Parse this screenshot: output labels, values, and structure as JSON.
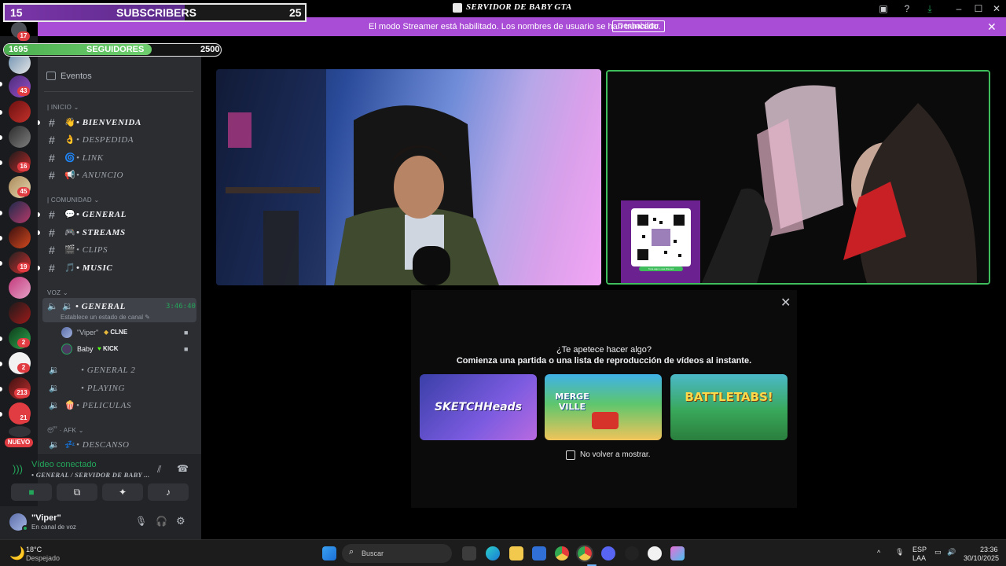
{
  "window": {
    "title": "SERVIDOR DE BABY GTA"
  },
  "overlay": {
    "subscribers": {
      "current": "15",
      "label": "SUBSCRIBERS",
      "goal": "25",
      "progress": 0.6
    },
    "followers": {
      "current": "1695",
      "label": "SEGUIDORES",
      "goal": "2500",
      "progress": 0.68,
      "clipped_server_text": "A"
    }
  },
  "banner": {
    "message": "El modo Streamer está habilitado. Los nombres de usuario se han truncado.",
    "button": "Deshabilitar",
    "close": "✕",
    "color": "#a94cd6"
  },
  "servers": {
    "badges": [
      "17",
      "43",
      "16",
      "45",
      "19",
      "2",
      "2",
      "213",
      "21"
    ],
    "new_label": "NUEVO"
  },
  "sidebar": {
    "events": "Eventos",
    "categories": {
      "inicio": "INICIO",
      "comunidad": "COMUNIDAD",
      "voz": "VOZ",
      "afk": "AFK"
    },
    "text_channels": [
      {
        "emoji": "👋",
        "name": "• BIENVENIDA"
      },
      {
        "emoji": "👌",
        "name": "• DESPEDIDA"
      },
      {
        "emoji": "🌀",
        "name": "• LINK"
      },
      {
        "emoji": "📢",
        "name": "• ANUNCIO"
      },
      {
        "emoji": "💬",
        "name": "• GENERAL"
      },
      {
        "emoji": "🎮",
        "name": "• STREAMS"
      },
      {
        "emoji": "🎬",
        "name": "• CLIPS"
      },
      {
        "emoji": "🎵",
        "name": "• MUSIC"
      }
    ],
    "voice_active": {
      "name": "• GENERAL",
      "timer": "3:46:40",
      "status_hint": "Establece un estado de canal",
      "members": [
        {
          "name": "\"Viper\"",
          "tag": "CLNE"
        },
        {
          "name": "Baby",
          "tag": "KICK"
        }
      ]
    },
    "voice_channels": [
      {
        "emoji": "",
        "name": "• GENERAL 2"
      },
      {
        "emoji": "",
        "name": "• PLAYING"
      },
      {
        "emoji": "🍿",
        "name": "• PELICULAS"
      }
    ],
    "afk_channel": {
      "emoji": "💤",
      "name": "• DESCANSO"
    }
  },
  "voice_panel": {
    "status": "Vídeo conectado",
    "location": "• GENERAL / SERVIDOR DE BABY ...",
    "status_color": "#23a55a"
  },
  "user_panel": {
    "name": "\"Viper\"",
    "status": "En canal de voz"
  },
  "activity_modal": {
    "title": "¿Te apetece hacer algo?",
    "subtitle": "Comienza una partida o una lista de reproducción de vídeos al instante.",
    "games": [
      "SKETCHHeads",
      "MERGE VILLE",
      "BATTLETABS!"
    ],
    "dont_show": "No volver a mostrar."
  },
  "video_tiles": {
    "qr_caption": "Toca aquí o usa Discord"
  },
  "taskbar": {
    "weather_temp": "18°C",
    "weather_desc": "Despejado",
    "search_placeholder": "Buscar",
    "lang_top": "ESP",
    "lang_bottom": "LAA",
    "time": "23:36",
    "date": "30/10/2025"
  }
}
